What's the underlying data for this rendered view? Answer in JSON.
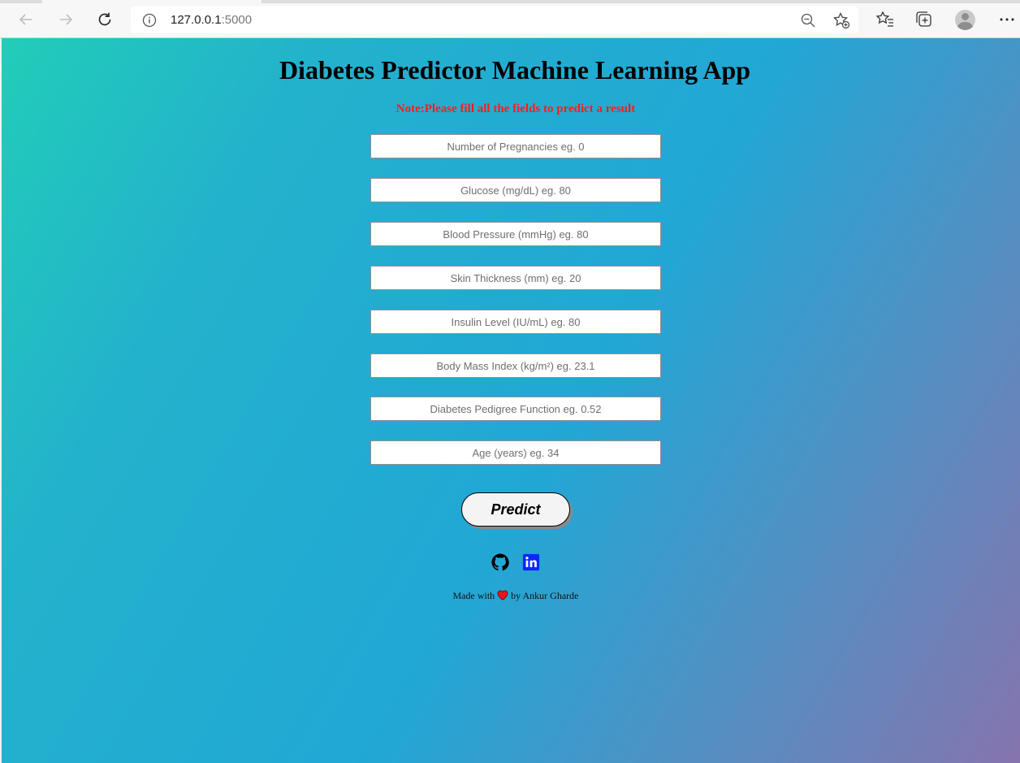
{
  "browser": {
    "url_host": "127.0.0.1",
    "url_port": ":5000",
    "icons": [
      "back-icon",
      "forward-icon",
      "refresh-icon",
      "info-icon",
      "zoom-out-icon",
      "add-favorite-icon",
      "favorites-icon",
      "collections-icon",
      "profile-avatar",
      "more-icon"
    ]
  },
  "app": {
    "title": "Diabetes Predictor Machine Learning App",
    "note": "Note:Please fill all the fields to predict a result",
    "fields": [
      {
        "placeholder": "Number of Pregnancies eg. 0"
      },
      {
        "placeholder": "Glucose (mg/dL) eg. 80"
      },
      {
        "placeholder": "Blood Pressure (mmHg) eg. 80"
      },
      {
        "placeholder": "Skin Thickness (mm) eg. 20"
      },
      {
        "placeholder": "Insulin Level (IU/mL) eg. 80"
      },
      {
        "placeholder": "Body Mass Index (kg/m²) eg. 23.1"
      },
      {
        "placeholder": "Diabetes Pedigree Function eg. 0.52"
      },
      {
        "placeholder": "Age (years) eg. 34"
      }
    ],
    "predict_label": "Predict",
    "footer": {
      "made_with": "Made with",
      "by": "by Ankur Gharde"
    },
    "social": [
      "github-icon",
      "linkedin-icon"
    ]
  },
  "colors": {
    "note": "#ff1a1a",
    "heart": "#e8161c",
    "linkedin": "#0a27ff",
    "gradient_start": "#22cdb8",
    "gradient_end": "#8674ae"
  }
}
